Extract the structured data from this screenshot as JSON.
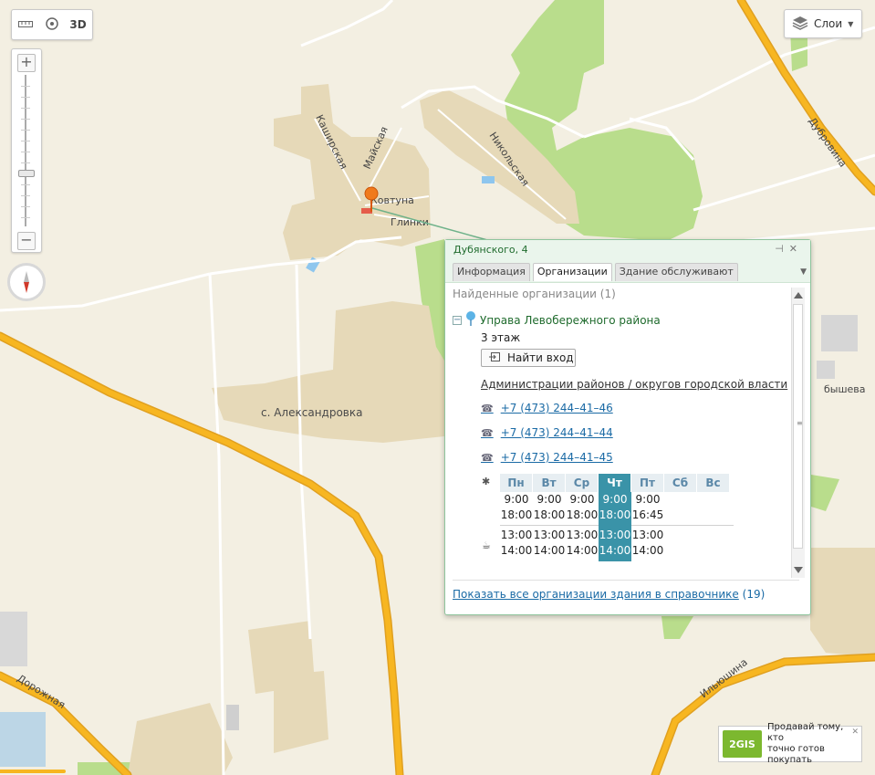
{
  "toolbar": {
    "button_3d_label": "3D"
  },
  "layers": {
    "label": "Слои"
  },
  "map": {
    "streets": {
      "kashirskaya": "Каширская",
      "mayskaya": "Майская",
      "kovtuna": "Ковтуна",
      "glinki": "Глинки",
      "nikolskaya": "Никольская",
      "dubrovina": "Дубровина",
      "dorozhnaya": "Дорожная",
      "ilyushina": "Ильюшина",
      "kuybysheva_partial": "бышева"
    },
    "village": "с. Александровка"
  },
  "popup": {
    "address": "Дубянского, 4",
    "tabs": [
      "Информация",
      "Организации",
      "Здание обслуживают"
    ],
    "active_tab": "Организации",
    "found": "Найденные организации (1)",
    "org_name": "Управа Левобережного района",
    "floor": "3 этаж",
    "find_entry": "Найти вход",
    "category": "Администрации районов / округов городской власти",
    "phones": [
      "+7 (473) 244–41–46",
      "+7 (473) 244–41–44",
      "+7 (473) 244–41–45"
    ],
    "schedule": {
      "days": [
        "Пн",
        "Вт",
        "Ср",
        "Чт",
        "Пт",
        "Сб",
        "Вс"
      ],
      "today_index": 3,
      "open": [
        "9:00",
        "9:00",
        "9:00",
        "9:00",
        "9:00"
      ],
      "close": [
        "18:00",
        "18:00",
        "18:00",
        "18:00",
        "16:45"
      ],
      "break_start": [
        "13:00",
        "13:00",
        "13:00",
        "13:00",
        "13:00"
      ],
      "break_end": [
        "14:00",
        "14:00",
        "14:00",
        "14:00",
        "14:00"
      ]
    },
    "footer_link": "Показать все организации здания в справочнике",
    "footer_count": "(19)"
  },
  "ad": {
    "logo": "2GIS",
    "text_line1": "Продавай тому, кто",
    "text_line2": "точно готов покупать"
  },
  "colors": {
    "map_background": "#f3efe2",
    "green_area": "#b8dd8a",
    "residential": "#e7dbbd",
    "highway": "#f5b31b",
    "popup_accent": "#3a93a8",
    "link": "#1a6aa5"
  }
}
